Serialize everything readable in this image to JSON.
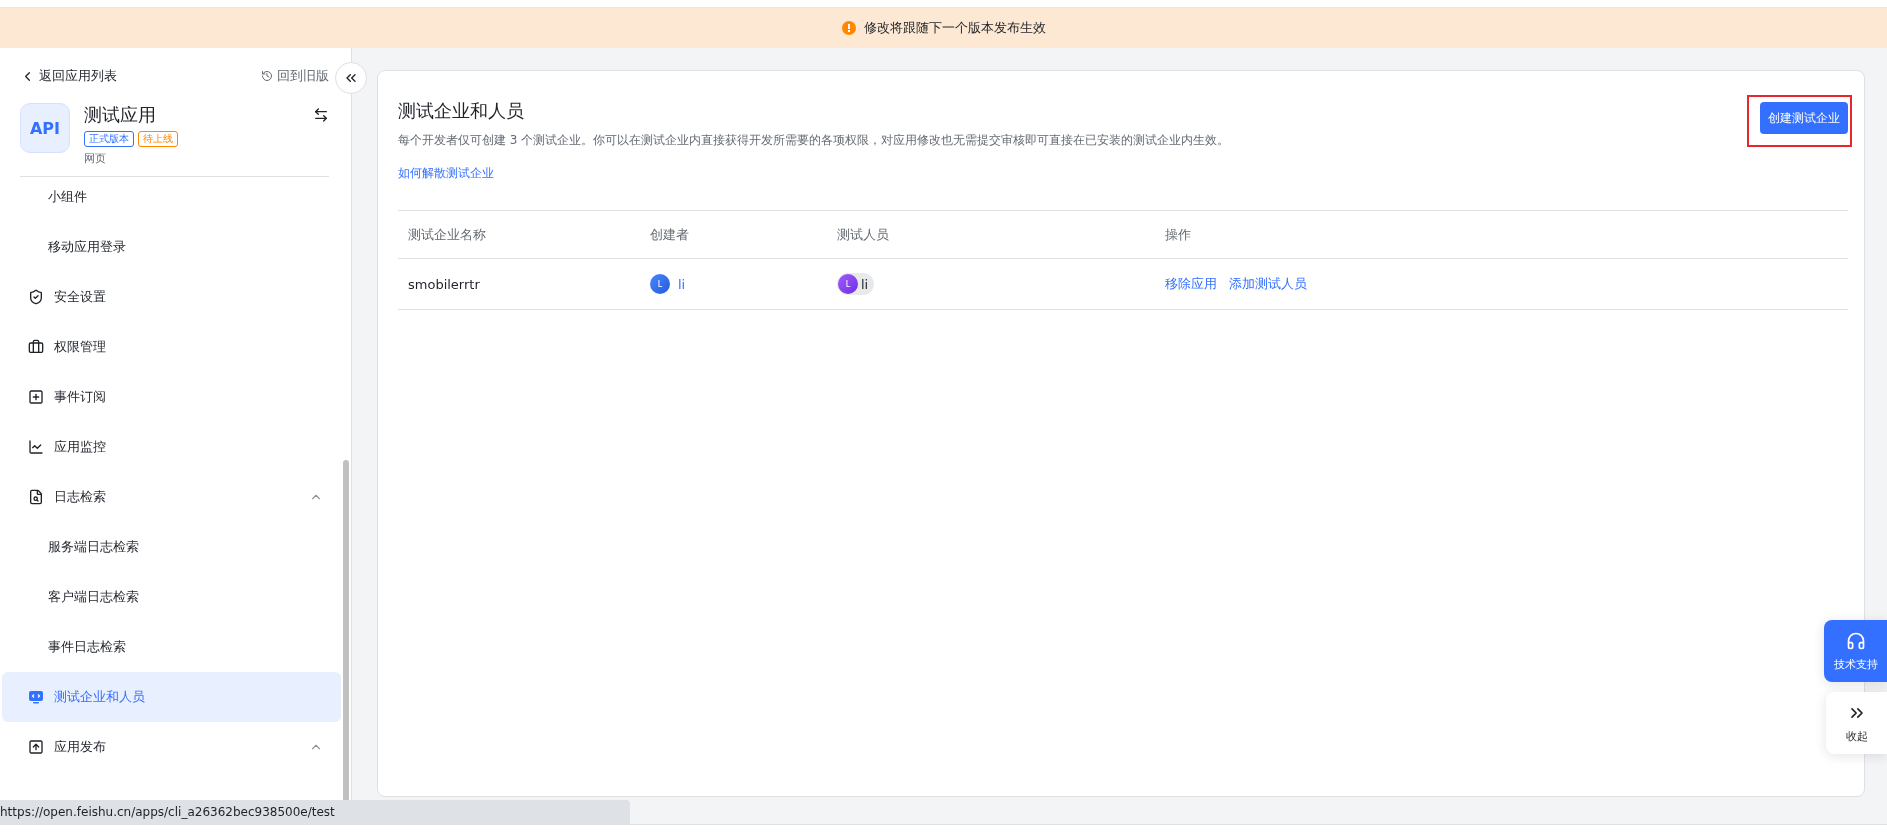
{
  "banner": {
    "text": "修改将跟随下一个版本发布生效"
  },
  "sidebar": {
    "back_link": "返回应用列表",
    "old_version_link": "回到旧版",
    "app": {
      "logo_text": "API",
      "name": "测试应用",
      "tags": [
        {
          "label": "正式版本",
          "color": "#3370ff"
        },
        {
          "label": "待上线",
          "color": "#ff8800"
        }
      ],
      "type": "网页"
    },
    "items": [
      {
        "label": "小组件",
        "kind": "sub",
        "selected": false
      },
      {
        "label": "移动应用登录",
        "kind": "sub",
        "selected": false
      },
      {
        "label": "安全设置",
        "kind": "main",
        "selected": false
      },
      {
        "label": "权限管理",
        "kind": "main",
        "selected": false
      },
      {
        "label": "事件订阅",
        "kind": "main",
        "selected": false
      },
      {
        "label": "应用监控",
        "kind": "main",
        "selected": false
      },
      {
        "label": "日志检索",
        "kind": "main",
        "selected": false,
        "expanded": true
      },
      {
        "label": "服务端日志检索",
        "kind": "sub",
        "selected": false
      },
      {
        "label": "客户端日志检索",
        "kind": "sub",
        "selected": false
      },
      {
        "label": "事件日志检索",
        "kind": "sub",
        "selected": false
      },
      {
        "label": "测试企业和人员",
        "kind": "main",
        "selected": true
      },
      {
        "label": "应用发布",
        "kind": "main",
        "selected": false,
        "expanded": true
      }
    ]
  },
  "main": {
    "title": "测试企业和人员",
    "description": "每个开发者仅可创建 3 个测试企业。你可以在测试企业内直接获得开发所需要的各项权限，对应用修改也无需提交审核即可直接在已安装的测试企业内生效。",
    "help_link": "如何解散测试企业",
    "create_button": "创建测试企业",
    "table": {
      "columns": [
        "测试企业名称",
        "创建者",
        "测试人员",
        "操作"
      ],
      "rows": [
        {
          "name": "smobilerrtr",
          "creator": {
            "avatar_letter": "L",
            "name": "li"
          },
          "tester": {
            "avatar_letter": "L",
            "name": "li"
          },
          "actions": [
            "移除应用",
            "添加测试人员"
          ]
        }
      ]
    }
  },
  "float_buttons": [
    {
      "label": "技术支持",
      "kind": "support"
    },
    {
      "label": "收起",
      "kind": "collapse"
    }
  ],
  "status_bar": {
    "url": "https://open.feishu.cn/apps/cli_a26362bec938500e/test"
  }
}
